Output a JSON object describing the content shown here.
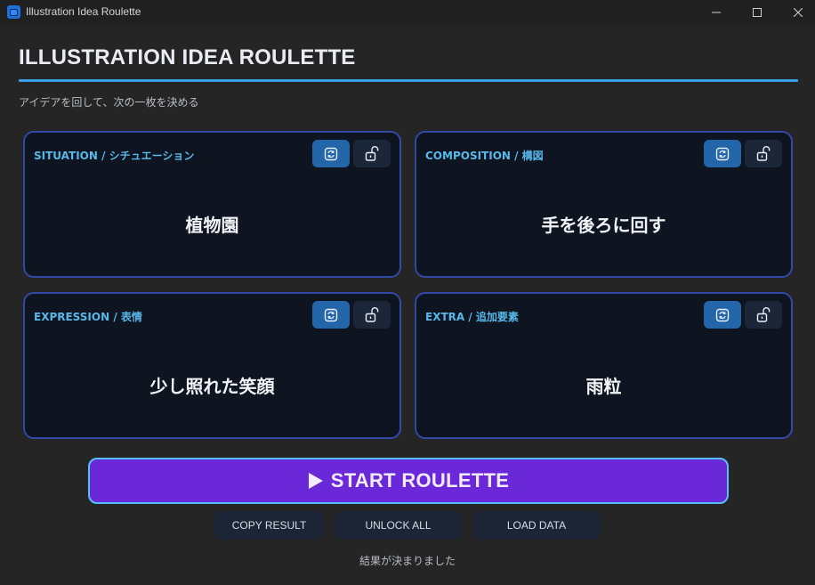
{
  "window": {
    "title": "Illustration Idea Roulette",
    "controls": [
      "minimize-icon",
      "maximize-icon",
      "close-icon"
    ]
  },
  "header": {
    "title": "ILLUSTRATION IDEA ROULETTE",
    "subtitle": "アイデアを回して、次の一枚を決める",
    "accent_color": "#3aa0e6"
  },
  "cards": [
    {
      "label": "SITUATION / シチュエーション",
      "value": "植物園",
      "shuffle_icon": "shuffle-icon",
      "lock_icon": "unlock-icon"
    },
    {
      "label": "COMPOSITION / 構図",
      "value": "手を後ろに回す",
      "shuffle_icon": "shuffle-icon",
      "lock_icon": "unlock-icon"
    },
    {
      "label": "EXPRESSION / 表情",
      "value": "少し照れた笑顔",
      "shuffle_icon": "shuffle-icon",
      "lock_icon": "unlock-icon"
    },
    {
      "label": "EXTRA / 追加要素",
      "value": "雨粒",
      "shuffle_icon": "shuffle-icon",
      "lock_icon": "unlock-icon"
    }
  ],
  "actions": {
    "start_label": "START ROULETTE",
    "copy_label": "COPY RESULT",
    "unlock_label": "UNLOCK ALL",
    "load_label": "LOAD DATA"
  },
  "status": "結果が決まりました",
  "colors": {
    "background": "#252525",
    "card_bg": "#0e1420",
    "card_border": "#3249a8",
    "label": "#57b8ea",
    "start_button": "#6a28d8",
    "start_border": "#56c0f4"
  }
}
